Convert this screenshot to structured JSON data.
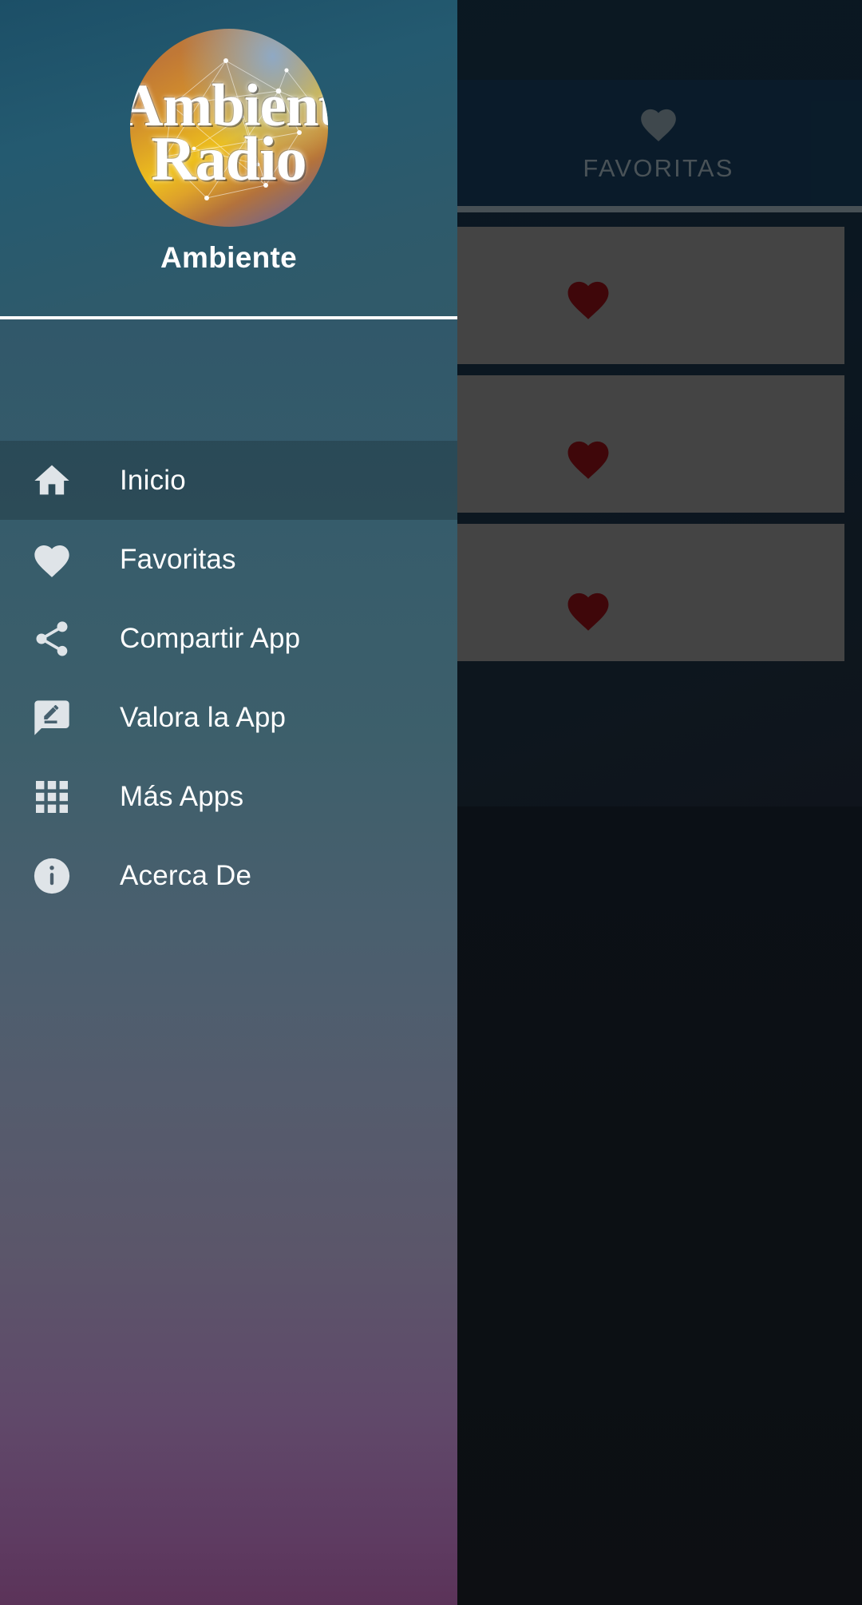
{
  "app": {
    "name": "Ambient Radio",
    "logo": {
      "line1": "Ambient",
      "line2": "Radio",
      "icon_name": "ambient-radio-logo"
    },
    "subtitle": "Ambiente"
  },
  "drawer": {
    "menu_items": [
      {
        "label": "Inicio",
        "icon": "home-icon",
        "selected": true
      },
      {
        "label": "Favoritas",
        "icon": "heart-icon",
        "selected": false
      },
      {
        "label": "Compartir App",
        "icon": "share-icon",
        "selected": false
      },
      {
        "label": "Valora la App",
        "icon": "rate-review-icon",
        "selected": false
      },
      {
        "label": "Más Apps",
        "icon": "apps-grid-icon",
        "selected": false
      },
      {
        "label": "Acerca De",
        "icon": "info-icon",
        "selected": false
      }
    ]
  },
  "background_screen": {
    "tab": {
      "label": "FAVORITAS",
      "icon": "heart-icon",
      "selected": true
    },
    "station_cards": [
      {
        "icon": "heart-filled-icon"
      },
      {
        "icon": "heart-filled-icon"
      },
      {
        "icon": "heart-filled-icon"
      }
    ]
  },
  "colors": {
    "drawer_header": "#245a70",
    "drawer_body_top": "#2e5569",
    "drawer_body_bottom": "#5b3359",
    "tab_bar": "#123049",
    "tab_label": "#7f8e97",
    "tab_indicator": "#7b8a93",
    "card_bg": "#767676",
    "heart_red": "#6d0d12",
    "menu_text": "#ffffff",
    "menu_icon": "#dfe4e8"
  }
}
